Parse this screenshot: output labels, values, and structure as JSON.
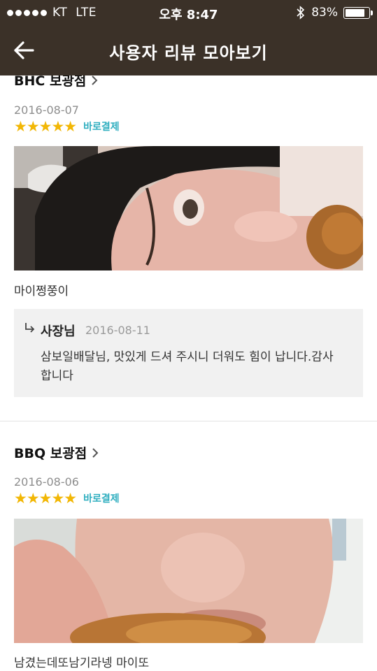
{
  "status_bar": {
    "carrier": "KT",
    "network": "LTE",
    "time": "오후 8:47",
    "battery_percent": "83%",
    "battery_level": 0.83,
    "signal_bars": 5
  },
  "nav": {
    "title": "사용자 리뷰 모아보기",
    "back_icon": "arrow-left-icon"
  },
  "reviews": [
    {
      "store": "BHC 보광점",
      "date": "2016-08-07",
      "stars": "★★★★★",
      "rating": 5,
      "payment_badge": "바로결제",
      "text": "마이쩡쭝이",
      "reply": {
        "author": "사장님",
        "date": "2016-08-11",
        "text": "삼보일배달님, 맛있게 드셔 주시니 더워도 힘이 납니다.감사 합니다"
      }
    },
    {
      "store": "BBQ 보광점",
      "date": "2016-08-06",
      "stars": "★★★★★",
      "rating": 5,
      "payment_badge": "바로결제",
      "text": "남겼는데또남기라넹 마이또"
    }
  ],
  "colors": {
    "header_bg": "#3b3128",
    "star": "#f2b705",
    "badge": "#2eaebf",
    "reply_bg": "#f1f1f1"
  }
}
